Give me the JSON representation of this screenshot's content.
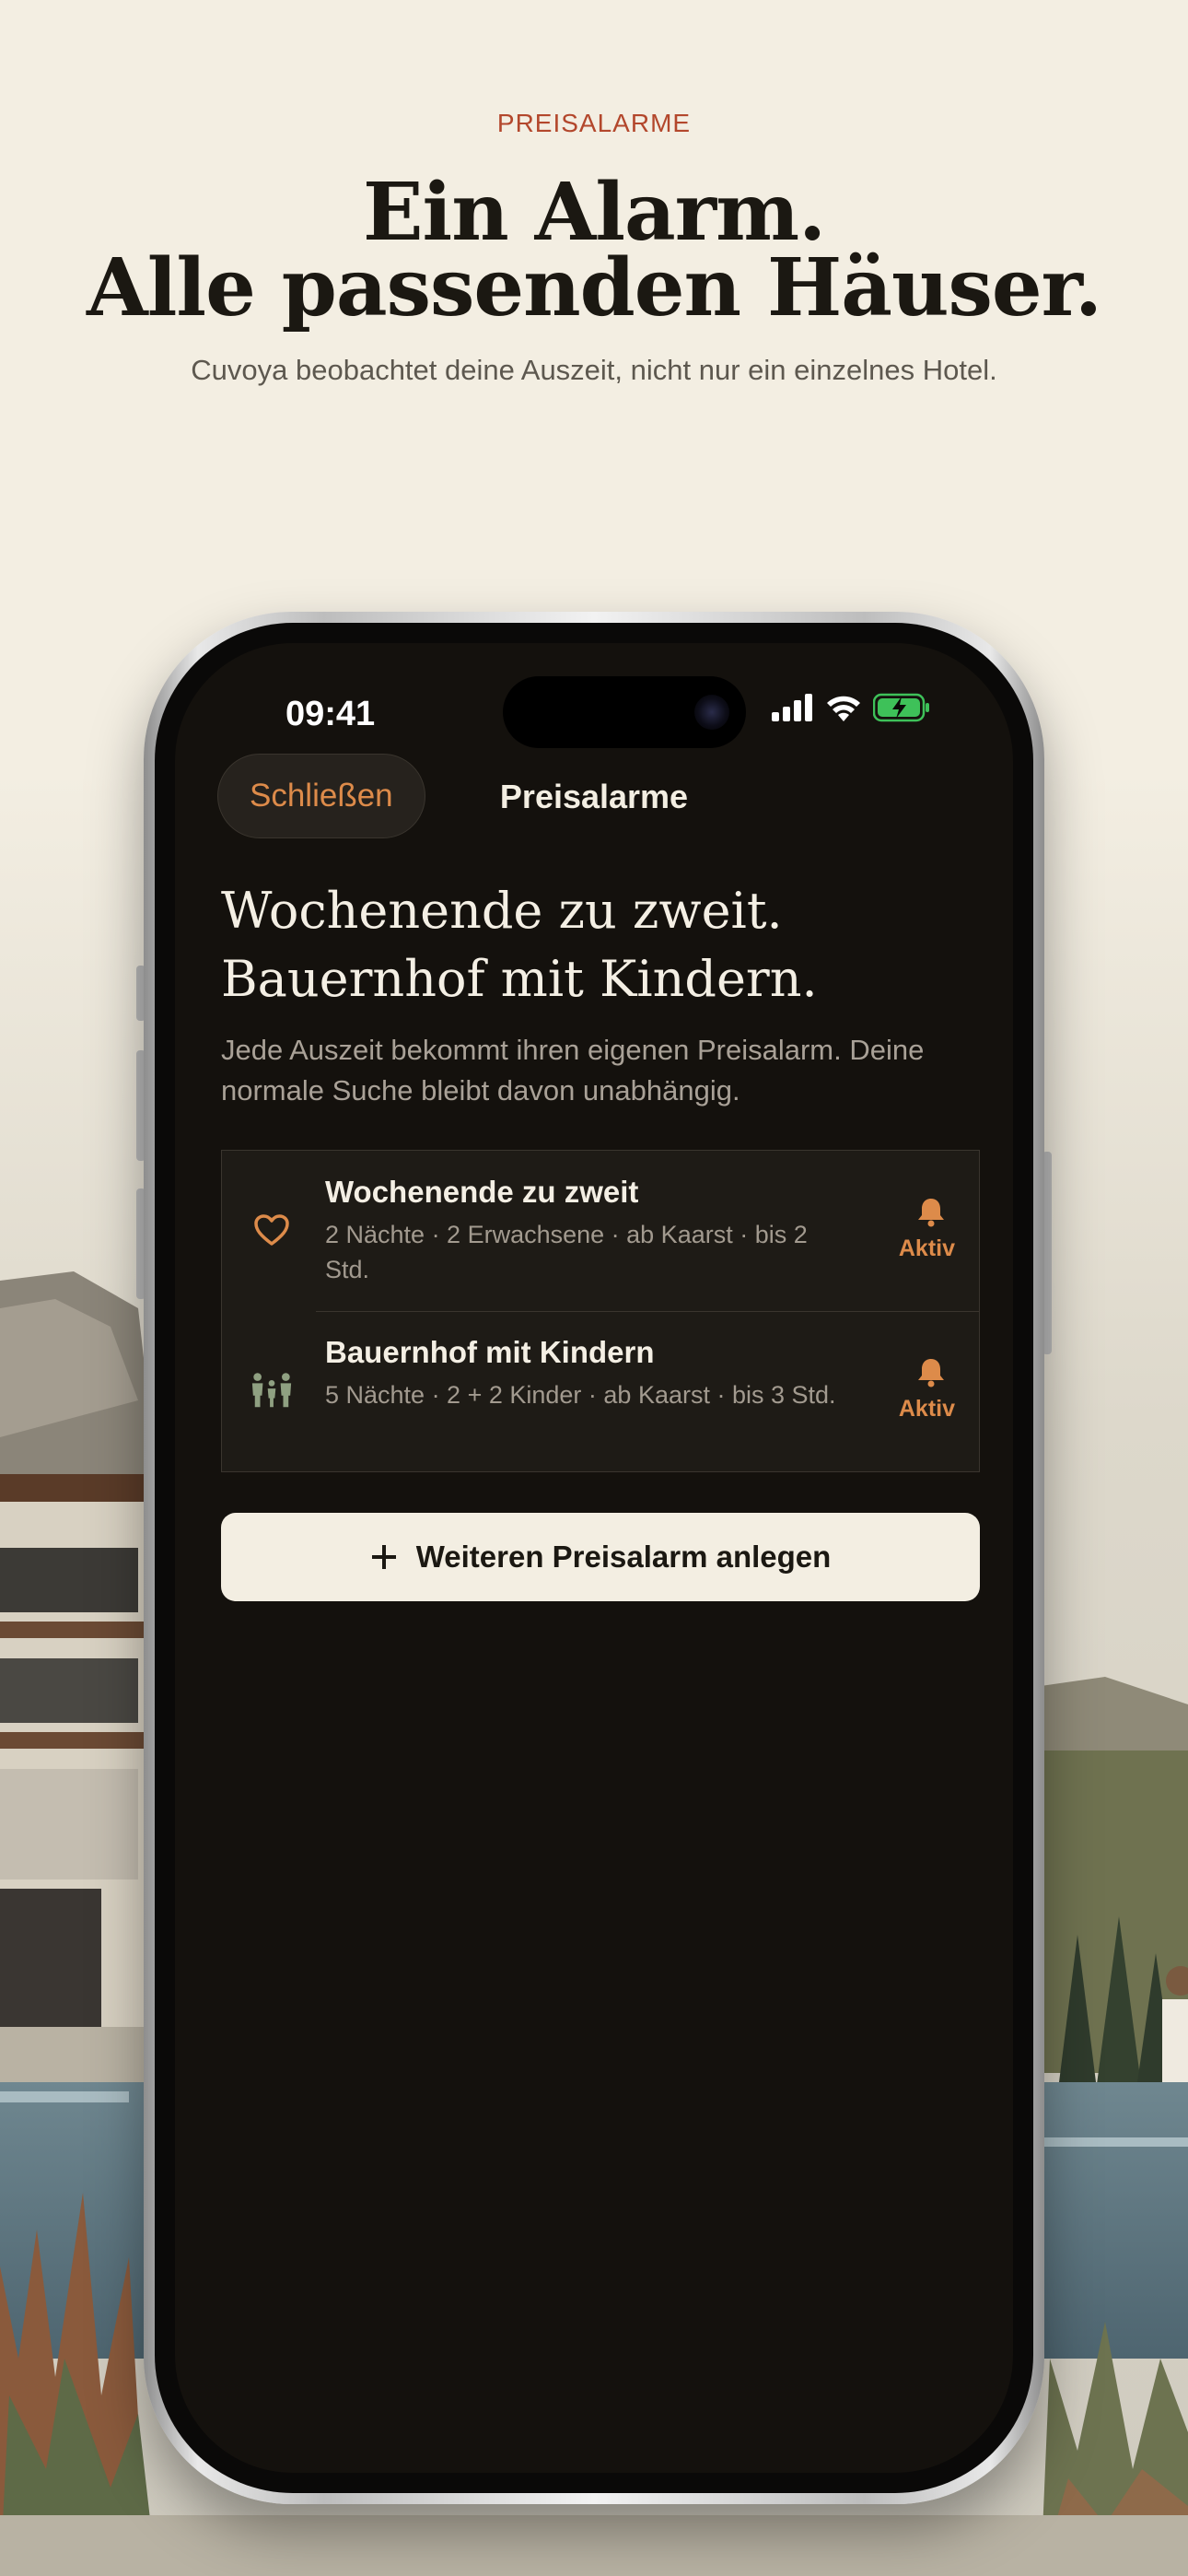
{
  "header": {
    "eyebrow": "PREISALARME",
    "headline_line1": "Ein Alarm.",
    "headline_line2": "Alle passenden Häuser.",
    "subline": "Cuvoya beobachtet deine Auszeit, nicht nur ein einzelnes Hotel."
  },
  "status_bar": {
    "time": "09:41",
    "icons": [
      "cellular-signal-icon",
      "wifi-icon",
      "battery-charging-icon"
    ]
  },
  "nav": {
    "close_label": "Schließen",
    "title": "Preisalarme"
  },
  "screen": {
    "heading_line1": "Wochenende zu zweit.",
    "heading_line2": "Bauernhof mit Kindern.",
    "description": "Jede Auszeit bekommt ihren eigenen Preisalarm. Deine normale Suche bleibt davon unabhängig."
  },
  "alarms": [
    {
      "icon": "heart-icon",
      "title": "Wochenende zu zweit",
      "meta": "2 Nächte · 2 Erwachsene · ab Kaarst · bis 2 Std.",
      "status": "Aktiv"
    },
    {
      "icon": "family-icon",
      "title": "Bauernhof mit Kindern",
      "meta": "5 Nächte · 2 + 2 Kinder · ab Kaarst · bis 3 Std.",
      "status": "Aktiv"
    }
  ],
  "add_button_label": "Weiteren Preisalarm anlegen",
  "colors": {
    "accent": "#dd8b4a",
    "eyebrow": "#b3472c",
    "screen_bg": "#14110d",
    "page_bg": "#f3eee2",
    "family_icon": "#8fa081"
  }
}
